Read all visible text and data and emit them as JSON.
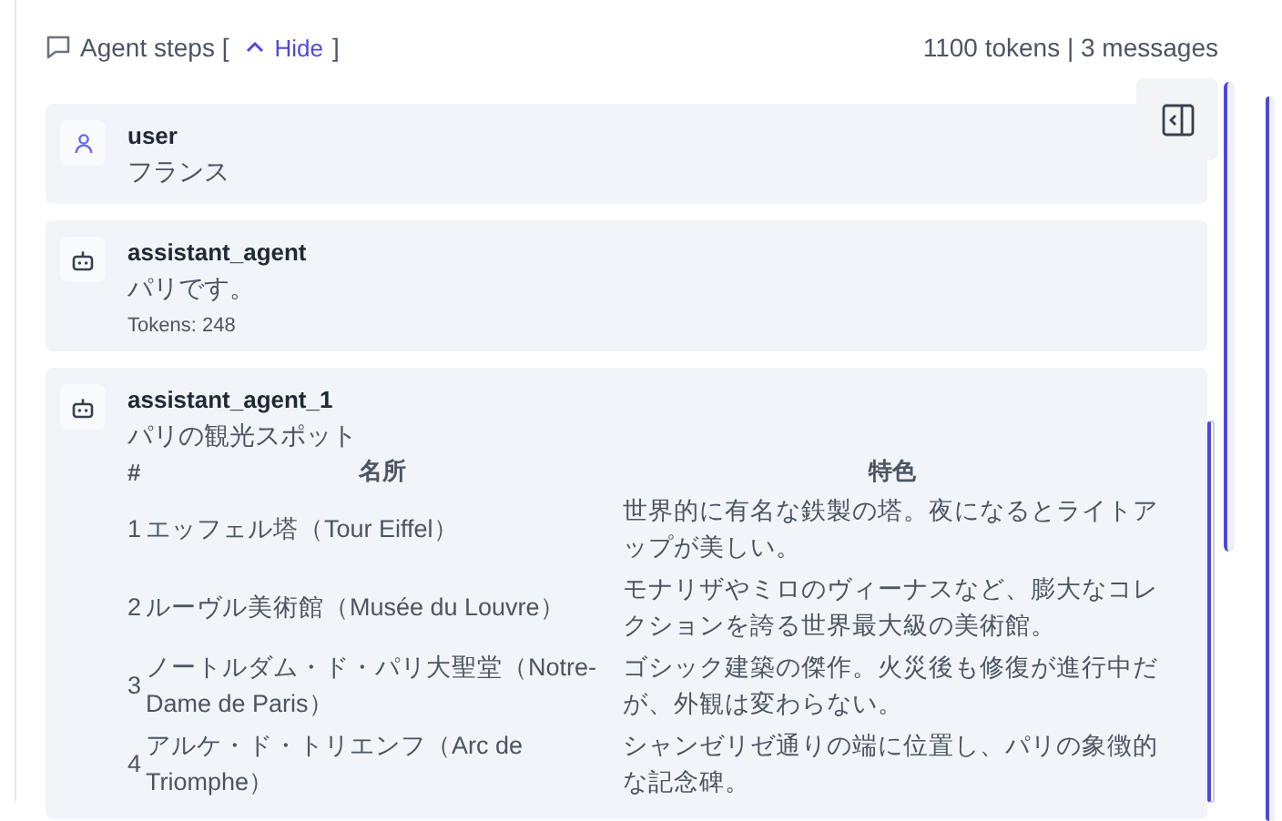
{
  "header": {
    "title": "Agent steps [",
    "toggle_label": "Hide",
    "bracket_close": "]",
    "stats": "1100 tokens | 3 messages"
  },
  "messages": [
    {
      "kind": "user",
      "sender": "user",
      "text": "フランス"
    },
    {
      "kind": "agent",
      "sender": "assistant_agent",
      "text": "パリです。",
      "tokens": "Tokens: 248"
    },
    {
      "kind": "agent",
      "sender": "assistant_agent_1",
      "text": "パリの観光スポット",
      "table": {
        "columns": [
          "#",
          "名所",
          "特色"
        ],
        "rows": [
          [
            "1",
            "エッフェル塔（Tour Eiffel）",
            "世界的に有名な鉄製の塔。夜になるとライトアップが美しい。"
          ],
          [
            "2",
            "ルーヴル美術館（Musée du Louvre）",
            "モナリザやミロのヴィーナスなど、膨大なコレクションを誇る世界最大級の美術館。"
          ],
          [
            "3",
            "ノートルダム・ド・パリ大聖堂（Notre-Dame de Paris）",
            "ゴシック建築の傑作。火災後も修復が進行中だが、外観は変わらない。"
          ],
          [
            "4",
            "アルケ・ド・トリエンフ（Arc de Triomphe）",
            "シャンゼリゼ通りの端に位置し、パリの象徴的な記念碑。"
          ]
        ]
      }
    }
  ]
}
